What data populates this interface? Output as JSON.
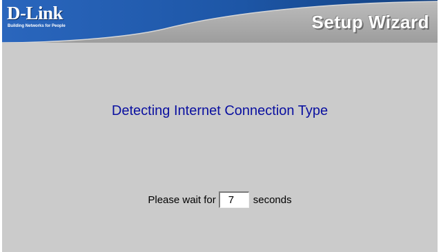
{
  "header": {
    "brand_name": "D-Link",
    "brand_tagline": "Building Networks for People",
    "title": "Setup Wizard"
  },
  "main": {
    "heading": "Detecting Internet Connection Type",
    "wait_prefix": "Please wait for",
    "countdown_value": "7",
    "wait_suffix": "seconds"
  },
  "colors": {
    "header_blue": "#1f5fb4",
    "header_gray": "#a9a9a9",
    "background": "#cbcbcb",
    "heading_text": "#0a10a0"
  }
}
